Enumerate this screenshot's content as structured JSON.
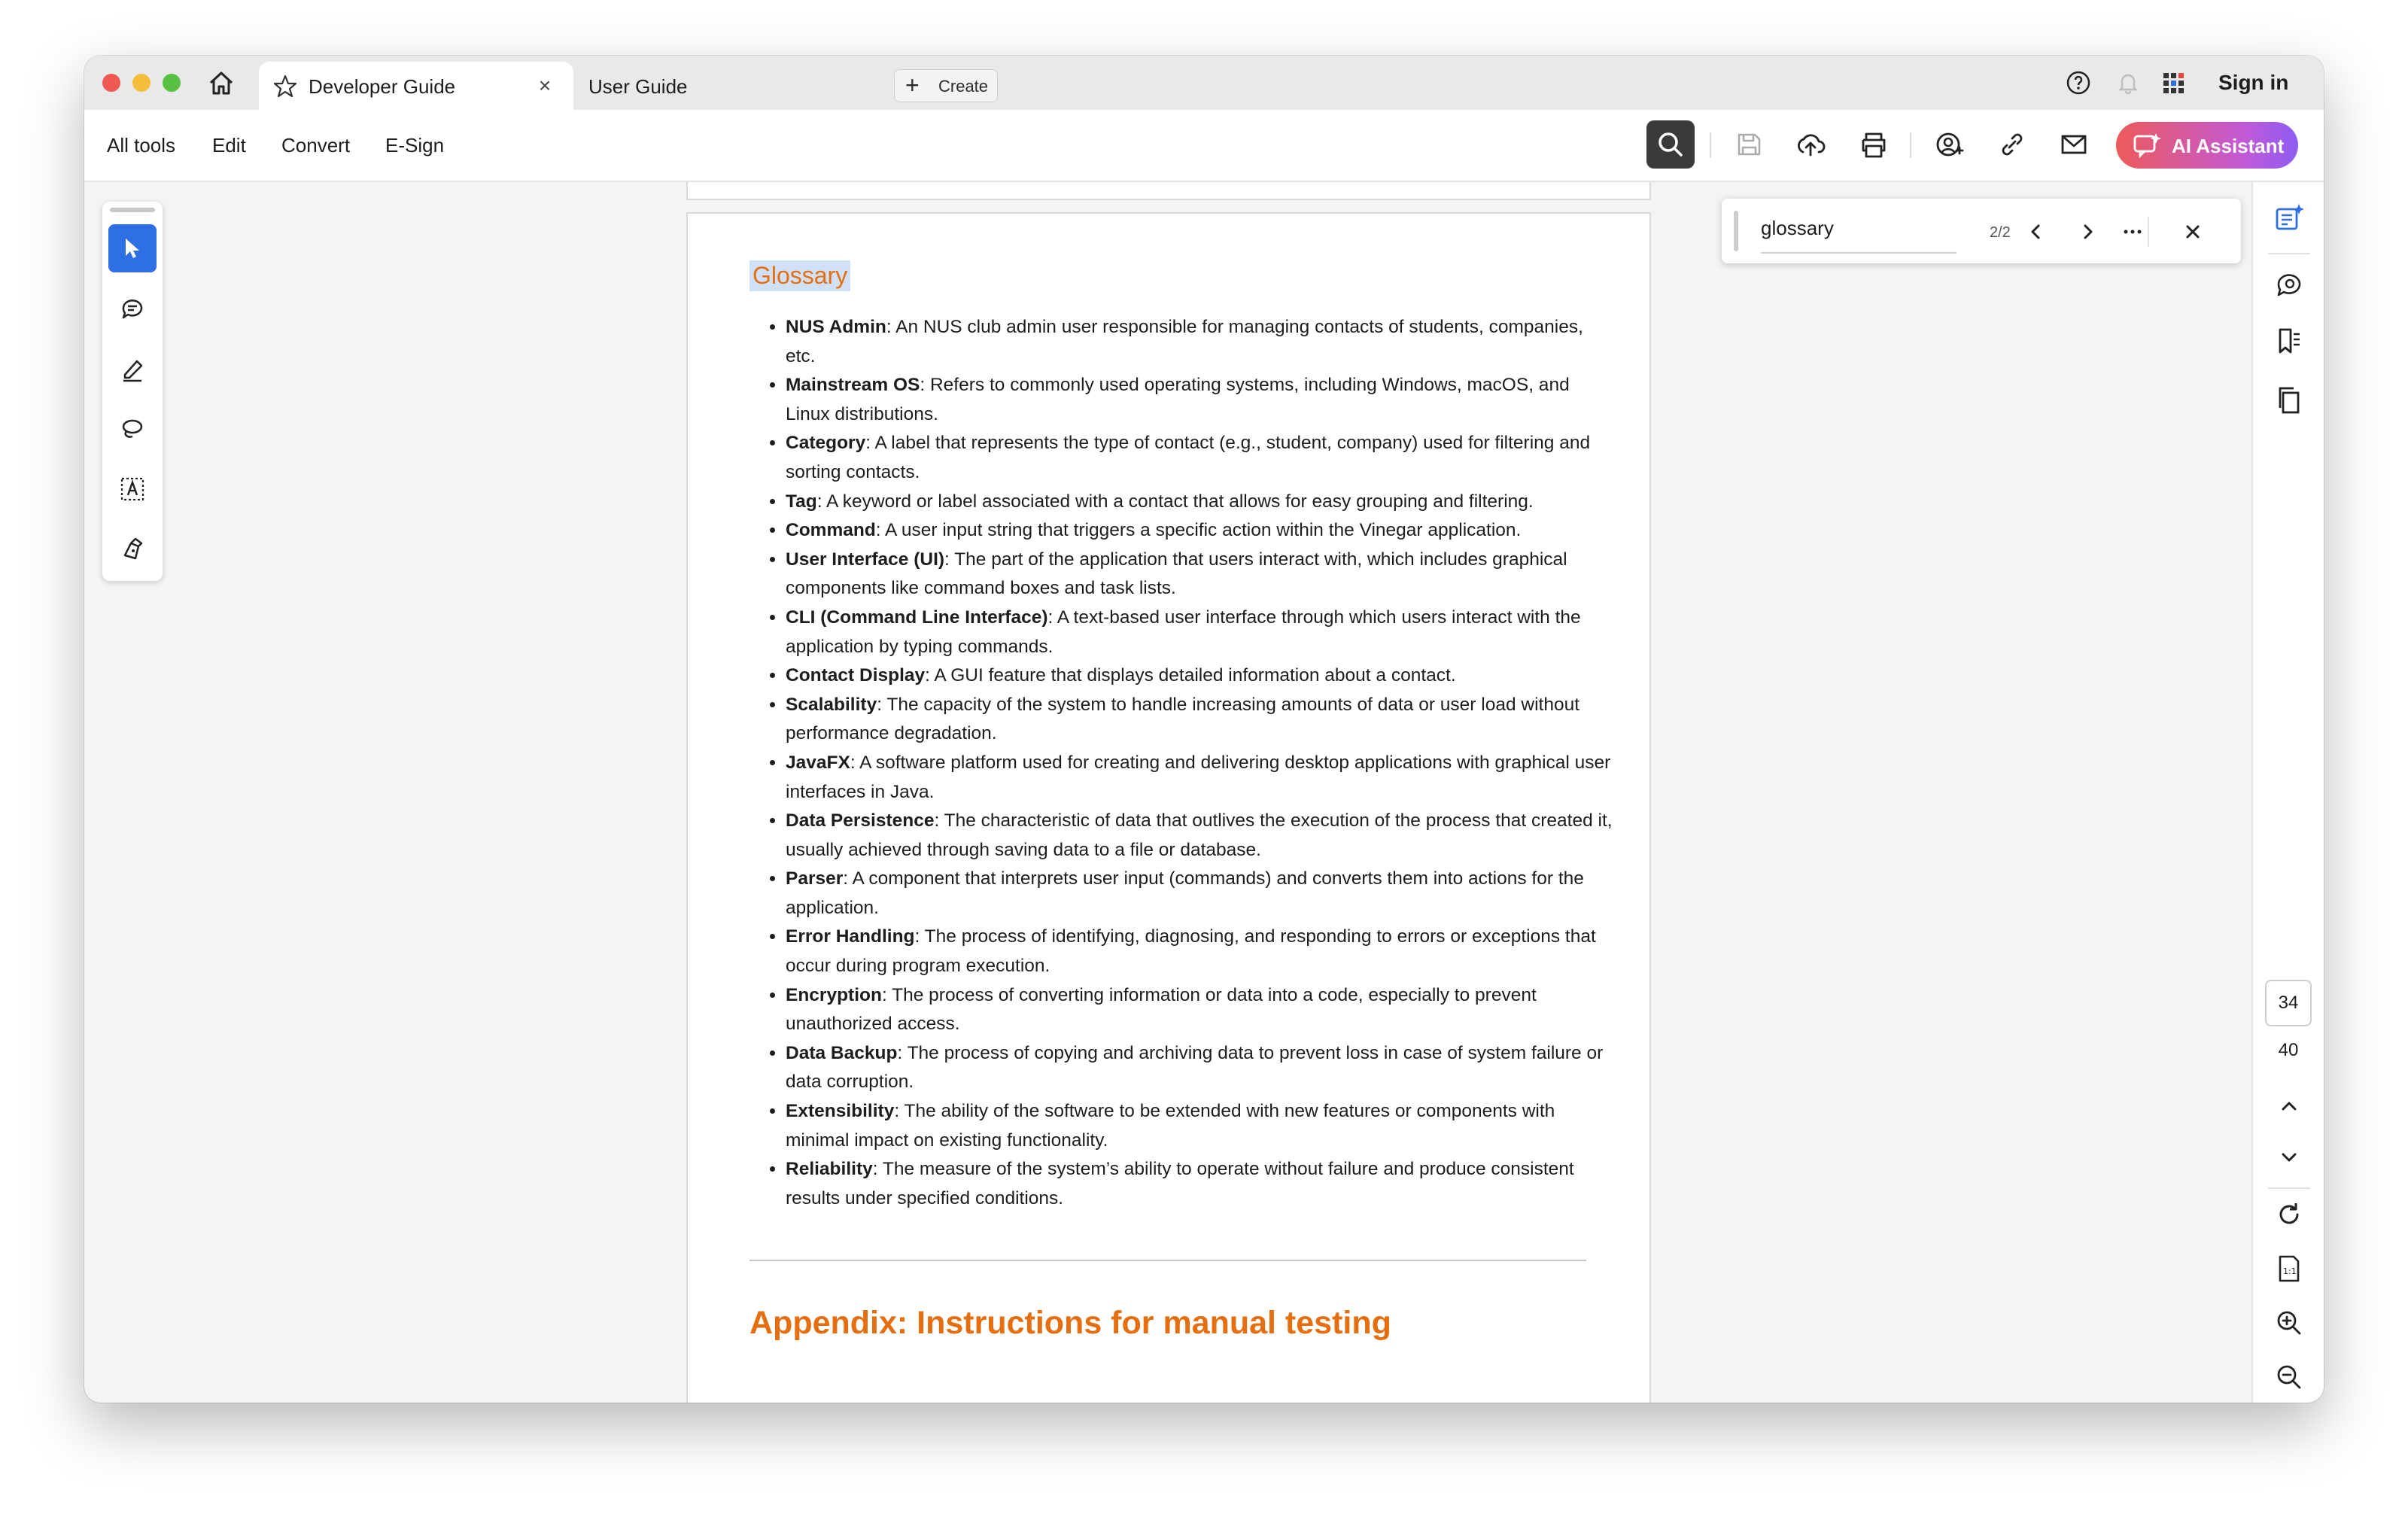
{
  "tabs": [
    {
      "label": "Developer Guide",
      "active": true
    },
    {
      "label": "User Guide",
      "active": false
    }
  ],
  "create_label": "Create",
  "sign_in": "Sign in",
  "menu": [
    "All tools",
    "Edit",
    "Convert",
    "E-Sign"
  ],
  "ai_assistant_label": "AI Assistant",
  "find": {
    "query": "glossary",
    "count": "2/2"
  },
  "document": {
    "glossary_heading": "Glossary",
    "terms": [
      {
        "term": "NUS Admin",
        "definition": ": An NUS club admin user responsible for managing contacts of students, companies, etc."
      },
      {
        "term": "Mainstream OS",
        "definition": ": Refers to commonly used operating systems, including Windows, macOS, and Linux distributions."
      },
      {
        "term": "Category",
        "definition": ": A label that represents the type of contact (e.g., student, company) used for filtering and sorting contacts."
      },
      {
        "term": "Tag",
        "definition": ": A keyword or label associated with a contact that allows for easy grouping and filtering."
      },
      {
        "term": "Command",
        "definition": ": A user input string that triggers a specific action within the Vinegar application."
      },
      {
        "term": "User Interface (UI)",
        "definition": ": The part of the application that users interact with, which includes graphical components like command boxes and task lists."
      },
      {
        "term": "CLI (Command Line Interface)",
        "definition": ": A text-based user interface through which users interact with the application by typing commands."
      },
      {
        "term": "Contact Display",
        "definition": ": A GUI feature that displays detailed information about a contact."
      },
      {
        "term": "Scalability",
        "definition": ": The capacity of the system to handle increasing amounts of data or user load without performance degradation."
      },
      {
        "term": "JavaFX",
        "definition": ": A software platform used for creating and delivering desktop applications with graphical user interfaces in Java."
      },
      {
        "term": "Data Persistence",
        "definition": ": The characteristic of data that outlives the execution of the process that created it, usually achieved through saving data to a file or database."
      },
      {
        "term": "Parser",
        "definition": ": A component that interprets user input (commands) and converts them into actions for the application."
      },
      {
        "term": "Error Handling",
        "definition": ": The process of identifying, diagnosing, and responding to errors or exceptions that occur during program execution."
      },
      {
        "term": "Encryption",
        "definition": ": The process of converting information or data into a code, especially to prevent unauthorized access."
      },
      {
        "term": "Data Backup",
        "definition": ": The process of copying and archiving data to prevent loss in case of system failure or data corruption."
      },
      {
        "term": "Extensibility",
        "definition": ": The ability of the software to be extended with new features or components with minimal impact on existing functionality."
      },
      {
        "term": "Reliability",
        "definition": ": The measure of the system’s ability to operate without failure and produce consistent results under specified conditions."
      }
    ],
    "appendix_heading": "Appendix: Instructions for manual testing"
  },
  "page_nav": {
    "current": "34",
    "total": "40"
  },
  "colors": {
    "accent_orange": "#e56f10",
    "selected_tool": "#2f6fe4",
    "highlight": "#cfe0f7"
  }
}
